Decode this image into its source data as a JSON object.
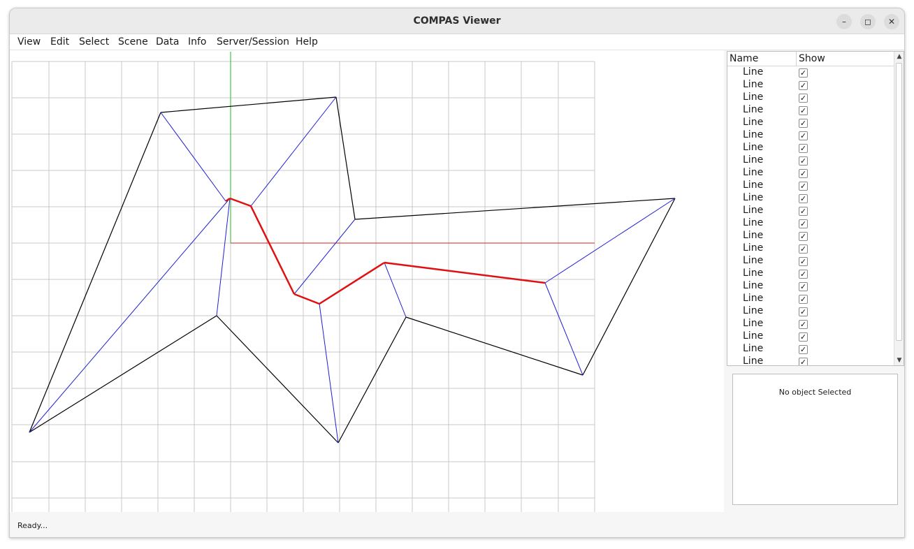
{
  "window": {
    "title": "COMPAS Viewer",
    "minimize_glyph": "–",
    "maximize_glyph": "◻",
    "close_glyph": "✕"
  },
  "menu": [
    "View",
    "Edit",
    "Select",
    "Scene",
    "Data",
    "Info",
    "Server/Session",
    "Help"
  ],
  "scene_tree": {
    "columns": [
      "Name",
      "Show"
    ],
    "rows": [
      {
        "name": "Line",
        "show": true
      },
      {
        "name": "Line",
        "show": true
      },
      {
        "name": "Line",
        "show": true
      },
      {
        "name": "Line",
        "show": true
      },
      {
        "name": "Line",
        "show": true
      },
      {
        "name": "Line",
        "show": true
      },
      {
        "name": "Line",
        "show": true
      },
      {
        "name": "Line",
        "show": true
      },
      {
        "name": "Line",
        "show": true
      },
      {
        "name": "Line",
        "show": true
      },
      {
        "name": "Line",
        "show": true
      },
      {
        "name": "Line",
        "show": true
      },
      {
        "name": "Line",
        "show": true
      },
      {
        "name": "Line",
        "show": true
      },
      {
        "name": "Line",
        "show": true
      },
      {
        "name": "Line",
        "show": true
      },
      {
        "name": "Line",
        "show": true
      },
      {
        "name": "Line",
        "show": true
      },
      {
        "name": "Line",
        "show": true
      },
      {
        "name": "Line",
        "show": true
      },
      {
        "name": "Line",
        "show": true
      },
      {
        "name": "Line",
        "show": true
      },
      {
        "name": "Line",
        "show": true
      },
      {
        "name": "Line",
        "show": true
      }
    ]
  },
  "properties": {
    "message": "No object Selected"
  },
  "status": "Ready...",
  "colors": {
    "grid": "#c8c8c8",
    "axis_x": "#cc2222",
    "axis_y": "#22bb22",
    "black_edge": "#000000",
    "blue_edge": "#1f1fd6",
    "red_edge": "#e01010"
  },
  "icons": {
    "scroll_up": "up-arrow-icon",
    "scroll_down": "down-arrow-icon",
    "checkbox": "checkmark-icon"
  }
}
